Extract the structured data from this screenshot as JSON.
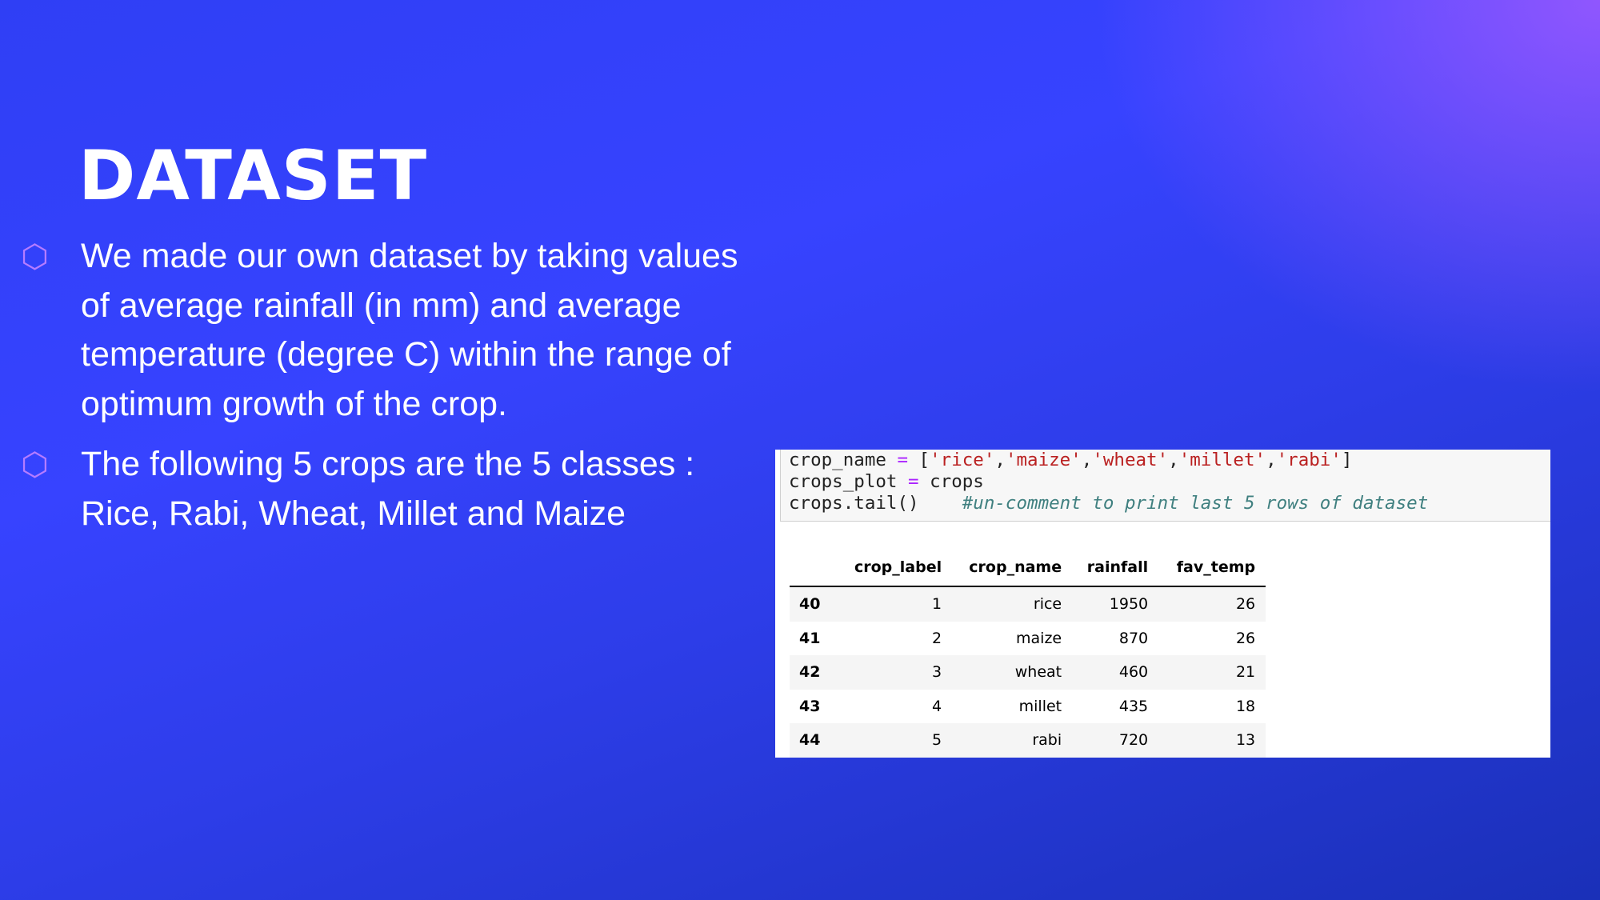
{
  "slide": {
    "title": "DATASET",
    "bullets": [
      "We made our own dataset by taking values of average rainfall (in mm) and average temperature (degree C) within the range of optimum growth of the crop.",
      "The following 5 crops are the 5 classes : Rice, Rabi, Wheat, Millet and Maize"
    ],
    "bullet_icon": "hexagon-outline",
    "colors": {
      "background_top_right": "#a05aff",
      "background_main": "#3743ff",
      "background_bottom_left": "#1a30b8",
      "bullet_icon": "#b57cff",
      "text": "#ffffff"
    }
  },
  "notebook": {
    "code_lines": [
      [
        {
          "t": "crop_name ",
          "c": "plain"
        },
        {
          "t": "=",
          "c": "op"
        },
        {
          "t": " [",
          "c": "plain"
        },
        {
          "t": "'rice'",
          "c": "str"
        },
        {
          "t": ",",
          "c": "plain"
        },
        {
          "t": "'maize'",
          "c": "str"
        },
        {
          "t": ",",
          "c": "plain"
        },
        {
          "t": "'wheat'",
          "c": "str"
        },
        {
          "t": ",",
          "c": "plain"
        },
        {
          "t": "'millet'",
          "c": "str"
        },
        {
          "t": ",",
          "c": "plain"
        },
        {
          "t": "'rabi'",
          "c": "str"
        },
        {
          "t": "]",
          "c": "plain"
        }
      ],
      [
        {
          "t": "crops_plot ",
          "c": "plain"
        },
        {
          "t": "=",
          "c": "op"
        },
        {
          "t": " crops",
          "c": "plain"
        }
      ],
      [
        {
          "t": "crops.tail()    ",
          "c": "plain"
        },
        {
          "t": "#un-comment to print last 5 rows of dataset",
          "c": "comment"
        }
      ]
    ],
    "table": {
      "columns": [
        "crop_label",
        "crop_name",
        "rainfall",
        "fav_temp"
      ],
      "rows": [
        {
          "index": "40",
          "cells": [
            "1",
            "rice",
            "1950",
            "26"
          ]
        },
        {
          "index": "41",
          "cells": [
            "2",
            "maize",
            "870",
            "26"
          ]
        },
        {
          "index": "42",
          "cells": [
            "3",
            "wheat",
            "460",
            "21"
          ]
        },
        {
          "index": "43",
          "cells": [
            "4",
            "millet",
            "435",
            "18"
          ]
        },
        {
          "index": "44",
          "cells": [
            "5",
            "rabi",
            "720",
            "13"
          ]
        }
      ]
    }
  }
}
